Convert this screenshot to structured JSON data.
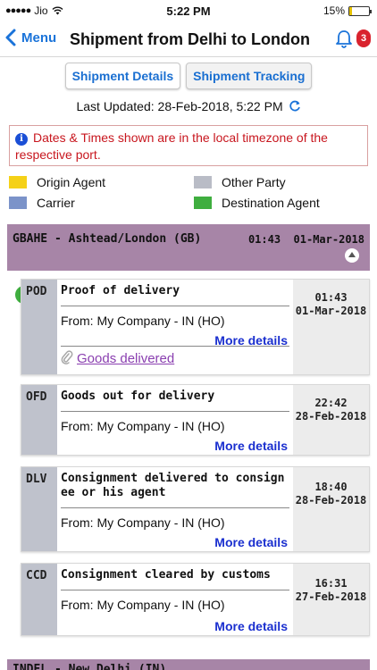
{
  "status_bar": {
    "carrier": "Jio",
    "time": "5:22 PM",
    "battery": "15%",
    "battery_level": 0.15,
    "battery_color": "#e6c200"
  },
  "nav": {
    "back_label": "Menu",
    "title": "Shipment from Delhi to London",
    "notification_count": "3",
    "accent_color": "#1a73d9"
  },
  "tabs": [
    {
      "label": "Shipment Details",
      "active": false
    },
    {
      "label": "Shipment Tracking",
      "active": true
    }
  ],
  "last_updated": "Last Updated: 28-Feb-2018, 5:22 PM",
  "notice": "Dates & Times shown are in the local timezone of the respective port.",
  "legend": [
    {
      "label": "Origin Agent",
      "color": "#f5d117"
    },
    {
      "label": "Other Party",
      "color": "#b9bcc6"
    },
    {
      "label": "Carrier",
      "color": "#7b93c9"
    },
    {
      "label": "Destination Agent",
      "color": "#3fae3f"
    }
  ],
  "group": {
    "name": "GBAHE - Ashtead/London (GB)",
    "time": "01:43",
    "date": "01-Mar-2018",
    "color": "#a785a7"
  },
  "events": [
    {
      "code": "POD",
      "title": "Proof of delivery",
      "from": "From: My Company - IN (HO)",
      "more": "More details",
      "time": "01:43",
      "date": "01-Mar-2018",
      "attachment": "Goods delivered"
    },
    {
      "code": "OFD",
      "title": "Goods out for delivery",
      "from": "From: My Company - IN (HO)",
      "more": "More details",
      "time": "22:42",
      "date": "28-Feb-2018"
    },
    {
      "code": "DLV",
      "title_line1": "Consignment delivered to consign",
      "title_line2": "ee or his agent",
      "from": "From: My Company - IN (HO)",
      "more": "More details",
      "time": "18:40",
      "date": "28-Feb-2018"
    },
    {
      "code": "CCD",
      "title": "Consignment cleared by customs",
      "from": "From: My Company - IN (HO)",
      "more": "More details",
      "time": "16:31",
      "date": "27-Feb-2018"
    }
  ],
  "next_group": {
    "name": "INDEL - New Delhi (IN)"
  }
}
